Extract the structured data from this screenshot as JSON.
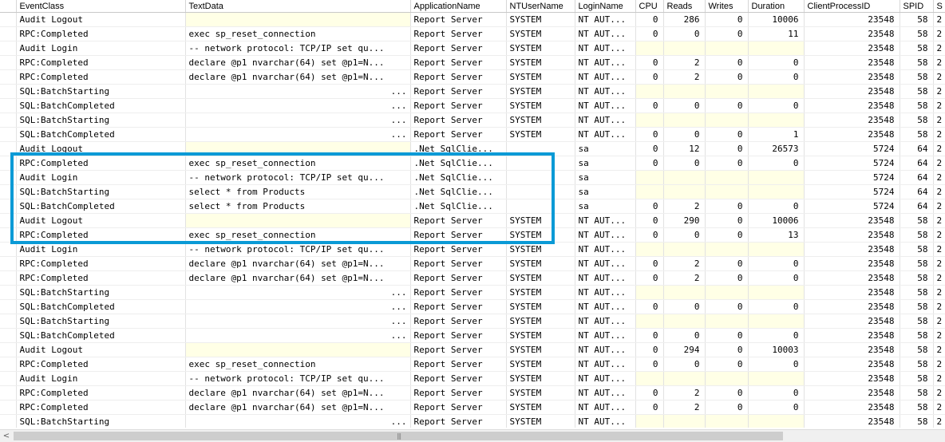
{
  "columns": [
    "EventClass",
    "TextData",
    "ApplicationName",
    "NTUserName",
    "LoginName",
    "CPU",
    "Reads",
    "Writes",
    "Duration",
    "ClientProcessID",
    "SPID",
    "S"
  ],
  "rows": [
    {
      "event": "Audit Logout",
      "text": "",
      "app": "Report Server",
      "nt": "SYSTEM",
      "login": "NT AUT...",
      "cpu": "0",
      "reads": "286",
      "writes": "0",
      "duration": "10006",
      "cpid": "23548",
      "spid": "58",
      "s": "2"
    },
    {
      "event": "RPC:Completed",
      "text": "exec sp_reset_connection",
      "app": "Report Server",
      "nt": "SYSTEM",
      "login": "NT AUT...",
      "cpu": "0",
      "reads": "0",
      "writes": "0",
      "duration": "11",
      "cpid": "23548",
      "spid": "58",
      "s": "2"
    },
    {
      "event": "Audit Login",
      "text": "-- network protocol: TCP/IP  set qu...",
      "app": "Report Server",
      "nt": "SYSTEM",
      "login": "NT AUT...",
      "cpu": "",
      "reads": "",
      "writes": "",
      "duration": "",
      "cpid": "23548",
      "spid": "58",
      "s": "2"
    },
    {
      "event": "RPC:Completed",
      "text": "declare @p1 nvarchar(64)  set @p1=N...",
      "app": "Report Server",
      "nt": "SYSTEM",
      "login": "NT AUT...",
      "cpu": "0",
      "reads": "2",
      "writes": "0",
      "duration": "0",
      "cpid": "23548",
      "spid": "58",
      "s": "2"
    },
    {
      "event": "RPC:Completed",
      "text": "declare @p1 nvarchar(64)  set @p1=N...",
      "app": "Report Server",
      "nt": "SYSTEM",
      "login": "NT AUT...",
      "cpu": "0",
      "reads": "2",
      "writes": "0",
      "duration": "0",
      "cpid": "23548",
      "spid": "58",
      "s": "2"
    },
    {
      "event": "SQL:BatchStarting",
      "text": "...",
      "app": "Report Server",
      "nt": "SYSTEM",
      "login": "NT AUT...",
      "cpu": "",
      "reads": "",
      "writes": "",
      "duration": "",
      "cpid": "23548",
      "spid": "58",
      "s": "2"
    },
    {
      "event": "SQL:BatchCompleted",
      "text": "...",
      "app": "Report Server",
      "nt": "SYSTEM",
      "login": "NT AUT...",
      "cpu": "0",
      "reads": "0",
      "writes": "0",
      "duration": "0",
      "cpid": "23548",
      "spid": "58",
      "s": "2"
    },
    {
      "event": "SQL:BatchStarting",
      "text": "...",
      "app": "Report Server",
      "nt": "SYSTEM",
      "login": "NT AUT...",
      "cpu": "",
      "reads": "",
      "writes": "",
      "duration": "",
      "cpid": "23548",
      "spid": "58",
      "s": "2"
    },
    {
      "event": "SQL:BatchCompleted",
      "text": "...",
      "app": "Report Server",
      "nt": "SYSTEM",
      "login": "NT AUT...",
      "cpu": "0",
      "reads": "0",
      "writes": "0",
      "duration": "1",
      "cpid": "23548",
      "spid": "58",
      "s": "2"
    },
    {
      "event": "Audit Logout",
      "text": "",
      "app": ".Net SqlClie...",
      "nt": "",
      "login": "sa",
      "cpu": "0",
      "reads": "12",
      "writes": "0",
      "duration": "26573",
      "cpid": "5724",
      "spid": "64",
      "s": "2"
    },
    {
      "event": "RPC:Completed",
      "text": "exec sp_reset_connection",
      "app": ".Net SqlClie...",
      "nt": "",
      "login": "sa",
      "cpu": "0",
      "reads": "0",
      "writes": "0",
      "duration": "0",
      "cpid": "5724",
      "spid": "64",
      "s": "2"
    },
    {
      "event": "Audit Login",
      "text": "-- network protocol: TCP/IP  set qu...",
      "app": ".Net SqlClie...",
      "nt": "",
      "login": "sa",
      "cpu": "",
      "reads": "",
      "writes": "",
      "duration": "",
      "cpid": "5724",
      "spid": "64",
      "s": "2"
    },
    {
      "event": "SQL:BatchStarting",
      "text": "select * from Products",
      "app": ".Net SqlClie...",
      "nt": "",
      "login": "sa",
      "cpu": "",
      "reads": "",
      "writes": "",
      "duration": "",
      "cpid": "5724",
      "spid": "64",
      "s": "2"
    },
    {
      "event": "SQL:BatchCompleted",
      "text": "select * from Products",
      "app": ".Net SqlClie...",
      "nt": "",
      "login": "sa",
      "cpu": "0",
      "reads": "2",
      "writes": "0",
      "duration": "0",
      "cpid": "5724",
      "spid": "64",
      "s": "2"
    },
    {
      "event": "Audit Logout",
      "text": "",
      "app": "Report Server",
      "nt": "SYSTEM",
      "login": "NT AUT...",
      "cpu": "0",
      "reads": "290",
      "writes": "0",
      "duration": "10006",
      "cpid": "23548",
      "spid": "58",
      "s": "2"
    },
    {
      "event": "RPC:Completed",
      "text": "exec sp_reset_connection",
      "app": "Report Server",
      "nt": "SYSTEM",
      "login": "NT AUT...",
      "cpu": "0",
      "reads": "0",
      "writes": "0",
      "duration": "13",
      "cpid": "23548",
      "spid": "58",
      "s": "2"
    },
    {
      "event": "Audit Login",
      "text": "-- network protocol: TCP/IP  set qu...",
      "app": "Report Server",
      "nt": "SYSTEM",
      "login": "NT AUT...",
      "cpu": "",
      "reads": "",
      "writes": "",
      "duration": "",
      "cpid": "23548",
      "spid": "58",
      "s": "2"
    },
    {
      "event": "RPC:Completed",
      "text": "declare @p1 nvarchar(64)  set @p1=N...",
      "app": "Report Server",
      "nt": "SYSTEM",
      "login": "NT AUT...",
      "cpu": "0",
      "reads": "2",
      "writes": "0",
      "duration": "0",
      "cpid": "23548",
      "spid": "58",
      "s": "2"
    },
    {
      "event": "RPC:Completed",
      "text": "declare @p1 nvarchar(64)  set @p1=N...",
      "app": "Report Server",
      "nt": "SYSTEM",
      "login": "NT AUT...",
      "cpu": "0",
      "reads": "2",
      "writes": "0",
      "duration": "0",
      "cpid": "23548",
      "spid": "58",
      "s": "2"
    },
    {
      "event": "SQL:BatchStarting",
      "text": "...",
      "app": "Report Server",
      "nt": "SYSTEM",
      "login": "NT AUT...",
      "cpu": "",
      "reads": "",
      "writes": "",
      "duration": "",
      "cpid": "23548",
      "spid": "58",
      "s": "2"
    },
    {
      "event": "SQL:BatchCompleted",
      "text": "...",
      "app": "Report Server",
      "nt": "SYSTEM",
      "login": "NT AUT...",
      "cpu": "0",
      "reads": "0",
      "writes": "0",
      "duration": "0",
      "cpid": "23548",
      "spid": "58",
      "s": "2"
    },
    {
      "event": "SQL:BatchStarting",
      "text": "...",
      "app": "Report Server",
      "nt": "SYSTEM",
      "login": "NT AUT...",
      "cpu": "",
      "reads": "",
      "writes": "",
      "duration": "",
      "cpid": "23548",
      "spid": "58",
      "s": "2"
    },
    {
      "event": "SQL:BatchCompleted",
      "text": "...",
      "app": "Report Server",
      "nt": "SYSTEM",
      "login": "NT AUT...",
      "cpu": "0",
      "reads": "0",
      "writes": "0",
      "duration": "0",
      "cpid": "23548",
      "spid": "58",
      "s": "2"
    },
    {
      "event": "Audit Logout",
      "text": "",
      "app": "Report Server",
      "nt": "SYSTEM",
      "login": "NT AUT...",
      "cpu": "0",
      "reads": "294",
      "writes": "0",
      "duration": "10003",
      "cpid": "23548",
      "spid": "58",
      "s": "2"
    },
    {
      "event": "RPC:Completed",
      "text": "exec sp_reset_connection",
      "app": "Report Server",
      "nt": "SYSTEM",
      "login": "NT AUT...",
      "cpu": "0",
      "reads": "0",
      "writes": "0",
      "duration": "0",
      "cpid": "23548",
      "spid": "58",
      "s": "2"
    },
    {
      "event": "Audit Login",
      "text": "-- network protocol: TCP/IP  set qu...",
      "app": "Report Server",
      "nt": "SYSTEM",
      "login": "NT AUT...",
      "cpu": "",
      "reads": "",
      "writes": "",
      "duration": "",
      "cpid": "23548",
      "spid": "58",
      "s": "2"
    },
    {
      "event": "RPC:Completed",
      "text": "declare @p1 nvarchar(64)  set @p1=N...",
      "app": "Report Server",
      "nt": "SYSTEM",
      "login": "NT AUT...",
      "cpu": "0",
      "reads": "2",
      "writes": "0",
      "duration": "0",
      "cpid": "23548",
      "spid": "58",
      "s": "2"
    },
    {
      "event": "RPC:Completed",
      "text": "declare @p1 nvarchar(64)  set @p1=N...",
      "app": "Report Server",
      "nt": "SYSTEM",
      "login": "NT AUT...",
      "cpu": "0",
      "reads": "2",
      "writes": "0",
      "duration": "0",
      "cpid": "23548",
      "spid": "58",
      "s": "2"
    },
    {
      "event": "SQL:BatchStarting",
      "text": "...",
      "app": "Report Server",
      "nt": "SYSTEM",
      "login": "NT AUT...",
      "cpu": "",
      "reads": "",
      "writes": "",
      "duration": "",
      "cpid": "23548",
      "spid": "58",
      "s": "2"
    }
  ],
  "scrollbar": {
    "left_arrow": "<",
    "grip": "|||"
  },
  "colors": {
    "highlight_box": "#0a9ad6",
    "empty_cell": "#ffffe6"
  }
}
